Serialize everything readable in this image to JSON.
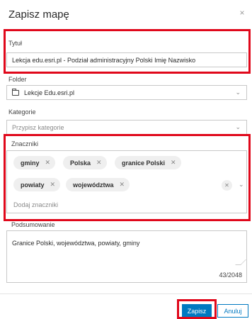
{
  "dialog": {
    "title": "Zapisz mapę",
    "close_glyph": "×"
  },
  "fields": {
    "title_label": "Tytuł",
    "title_value": "Lekcja edu.esri.pl - Podział administracyjny Polski Imię Nazwisko",
    "folder_label": "Folder",
    "folder_value": "Lekcje Edu.esri.pl",
    "category_label": "Kategorie",
    "category_placeholder": "Przypisz kategorie",
    "tags_label": "Znaczniki",
    "tags": [
      "gminy",
      "Polska",
      "granice Polski",
      "powiaty",
      "województwa"
    ],
    "tags_placeholder": "Dodaj znaczniki",
    "summary_label": "Podsumowanie",
    "summary_value": "Granice Polski, województwa, powiaty, gminy",
    "summary_counter": "43/2048"
  },
  "buttons": {
    "save_label": "Zapisz",
    "cancel_label": "Anuluj"
  },
  "icons": {
    "close": "close-icon",
    "folder": "folder-icon",
    "chevron": "chevron-down-icon",
    "tag_remove": "close-icon",
    "clear": "clear-icon"
  },
  "colors": {
    "primary": "#0079c1",
    "highlight": "#e0081b"
  }
}
